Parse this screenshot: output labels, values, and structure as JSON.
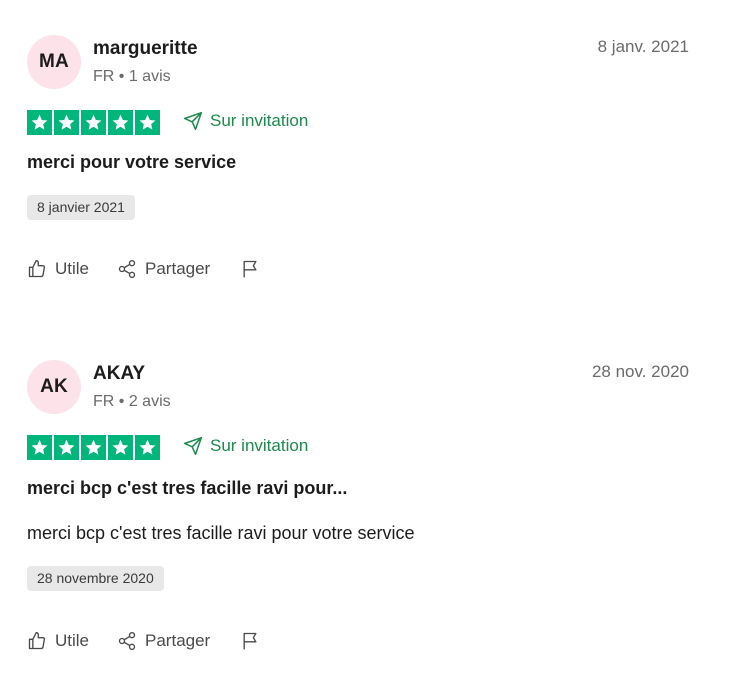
{
  "colors": {
    "star_green": "#00b67a",
    "invite_green": "#1b8a4b",
    "avatar_pink": "#fde2ea",
    "badge_gray": "#e8e8e8"
  },
  "reviews": [
    {
      "initials": "MA",
      "name": "margueritte",
      "meta": "FR • 1 avis",
      "date": "8 janv. 2021",
      "rating": 5,
      "invite_label": "Sur invitation",
      "title": "merci pour votre service",
      "body": "",
      "experience_date": "8 janvier 2021",
      "actions": {
        "useful": "Utile",
        "share": "Partager"
      }
    },
    {
      "initials": "AK",
      "name": "AKAY",
      "meta": "FR • 2 avis",
      "date": "28 nov. 2020",
      "rating": 5,
      "invite_label": "Sur invitation",
      "title": "merci bcp c'est tres facille ravi pour...",
      "body": "merci bcp c'est tres facille ravi pour votre service",
      "experience_date": "28 novembre 2020",
      "actions": {
        "useful": "Utile",
        "share": "Partager"
      }
    }
  ]
}
